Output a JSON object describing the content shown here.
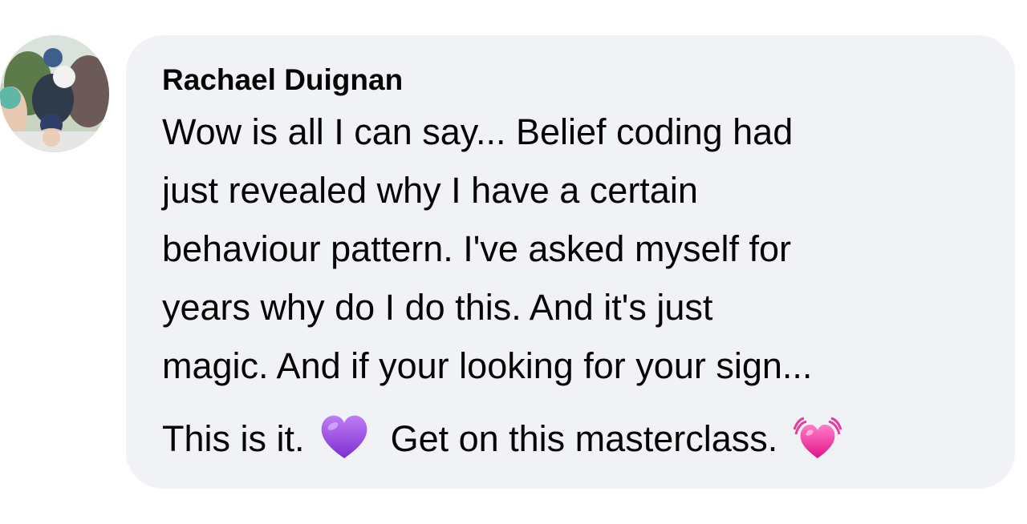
{
  "comment": {
    "author": "Rachael Duignan",
    "lines": [
      "Wow is all I can say... Belief coding had",
      "just revealed why I have a certain",
      "behaviour pattern. I've asked myself for",
      "years why do I do this. And it's just",
      "magic. And if your looking for your sign..."
    ],
    "last_line": {
      "part1": "This is it.",
      "emoji1": "purple-heart-icon",
      "part2": "Get on this masterclass.",
      "emoji2": "beating-heart-icon"
    }
  },
  "colors": {
    "bubble_bg": "#f0f2f5",
    "text": "#050505",
    "purple_heart": "#a259e6",
    "pink_heart": "#f03ca0"
  }
}
